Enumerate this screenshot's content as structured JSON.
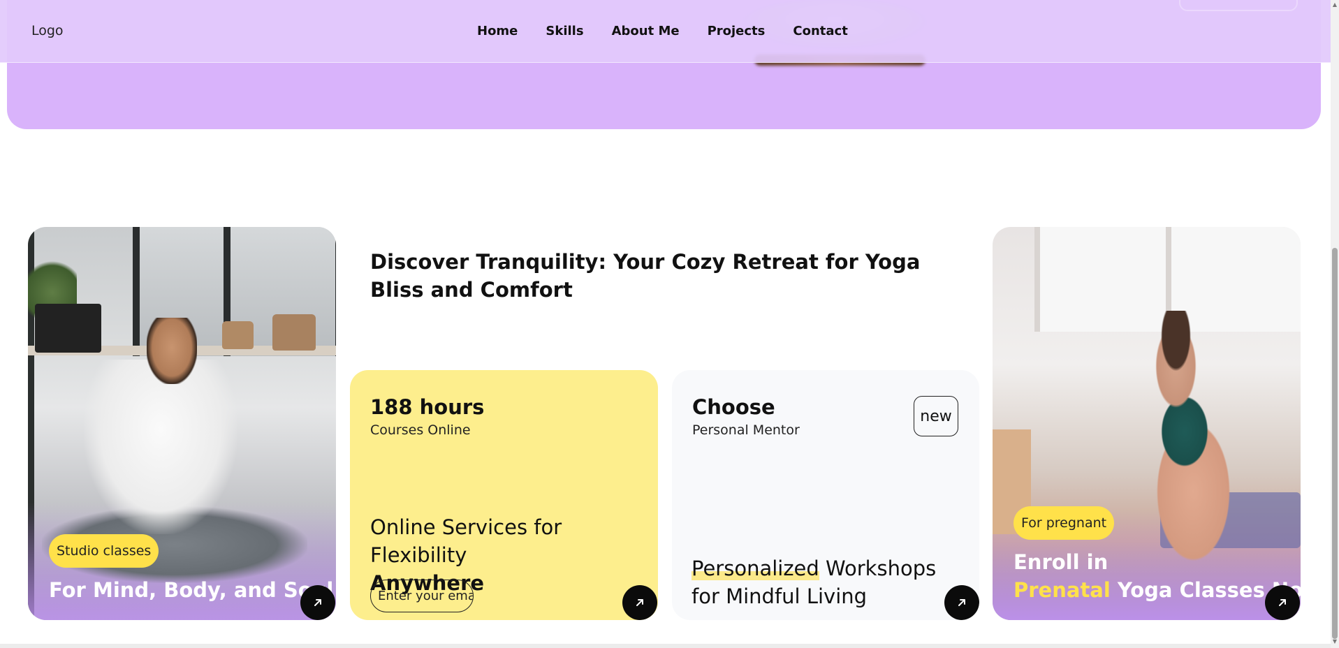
{
  "nav": {
    "logo": "Logo",
    "links": [
      "Home",
      "Skills",
      "About Me",
      "Projects",
      "Contact"
    ]
  },
  "section": {
    "heading": "Discover Tranquility: Your Cozy Retreat for Yoga Bliss and Comfort"
  },
  "cards": {
    "studio": {
      "badge": "Studio classes",
      "title": "For Mind, Body, and Soul"
    },
    "online": {
      "stat": "188 hours",
      "sub": "Courses Online",
      "text_line1": "Online Services for Flexibility",
      "text_bold": "Anywhere",
      "email_placeholder": "Enter your email"
    },
    "mentor": {
      "title": "Choose",
      "sub": "Personal Mentor",
      "badge": "new",
      "text_highlight": "Personalized",
      "text_rest": " Workshops for Mindful Living"
    },
    "prenatal": {
      "badge": "For pregnant",
      "title_line1": "Enroll in",
      "title_highlight": "Prenatal",
      "title_rest": " Yoga Classes Now"
    }
  },
  "colors": {
    "hero_purple": "#d9b3fb",
    "nav_bg": "#e2c9fc",
    "accent_yellow": "#ffe14a",
    "card_yellow": "#fdee8d",
    "card_grey": "#f8f9fb",
    "arrow_button": "#0b0b0b"
  },
  "icons": {
    "arrow": "arrow-up-right-icon"
  }
}
